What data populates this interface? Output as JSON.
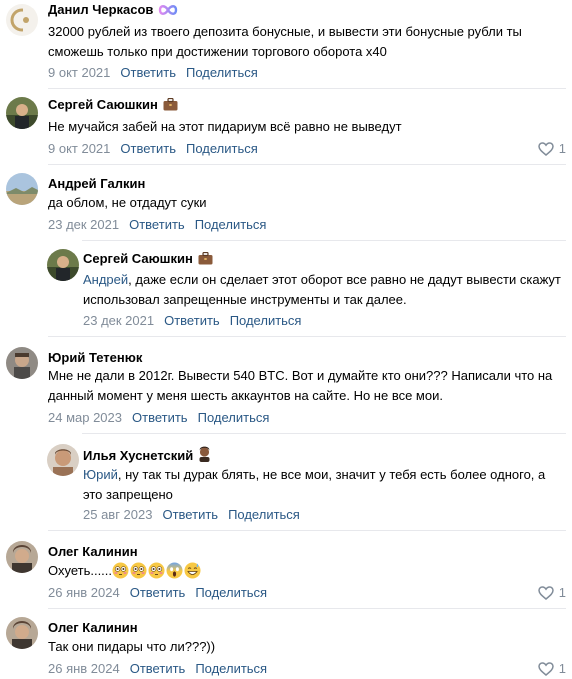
{
  "comments": [
    {
      "author": "Данил Черкасов",
      "badge": "infinity-badge-icon",
      "text": "32000 рублей из твоего депозита бонусные, и вывести эти бонусные рубли ты сможешь только при достижении торгового оборота х40",
      "date": "9 окт 2021",
      "reply_label": "Ответить",
      "share_label": "Поделиться"
    },
    {
      "author": "Сергей Саюшкин",
      "badge": "briefcase-badge-icon",
      "text": "Не мучайся забей на этот пидариум всё равно не выведут",
      "date": "9 окт 2021",
      "reply_label": "Ответить",
      "share_label": "Поделиться",
      "likes": "1"
    },
    {
      "author": "Андрей Галкин",
      "text": "да облом, не отдадут суки",
      "date": "23 дек 2021",
      "reply_label": "Ответить",
      "share_label": "Поделиться"
    },
    {
      "author": "Сергей Саюшкин",
      "badge": "briefcase-badge-icon",
      "mention": "Андрей",
      "text": ", даже если он сделает этот оборот все равно не дадут вывести скажут использовал запрещенные инструменты и так далее.",
      "date": "23 дек 2021",
      "reply_label": "Ответить",
      "share_label": "Поделиться"
    },
    {
      "author": "Юрий Тетенюк",
      "text": "Мне не дали в 2012г. Вывести 540 BTC. Вот и думайте кто они??? Написали что на данный момент у меня шесть аккаунтов на сайте. Но не все мои.",
      "date": "24 мар 2023",
      "reply_label": "Ответить",
      "share_label": "Поделиться"
    },
    {
      "author": "Илья Хуснетский",
      "badge": "man-emoji-badge-icon",
      "mention": "Юрий",
      "text": ", ну так ты дурак блять, не все мои, значит у тебя есть более одного, а это запрещено",
      "date": "25 авг 2023",
      "reply_label": "Ответить",
      "share_label": "Поделиться"
    },
    {
      "author": "Олег Калинин",
      "text": "Охуеть......",
      "emojis": [
        "flushed-face-icon",
        "flushed-face-icon",
        "flushed-face-icon",
        "screaming-face-icon",
        "grinning-sweat-face-icon"
      ],
      "date": "26 янв 2024",
      "reply_label": "Ответить",
      "share_label": "Поделиться",
      "likes": "1"
    },
    {
      "author": "Олег Калинин",
      "text": "Так они пидары что ли???))",
      "date": "26 янв 2024",
      "reply_label": "Ответить",
      "share_label": "Поделиться",
      "likes": "1"
    }
  ],
  "colors": {
    "link": "#2a5885",
    "meta": "#818c99",
    "separator": "#e7e8ec",
    "like_icon": "#818c99"
  }
}
